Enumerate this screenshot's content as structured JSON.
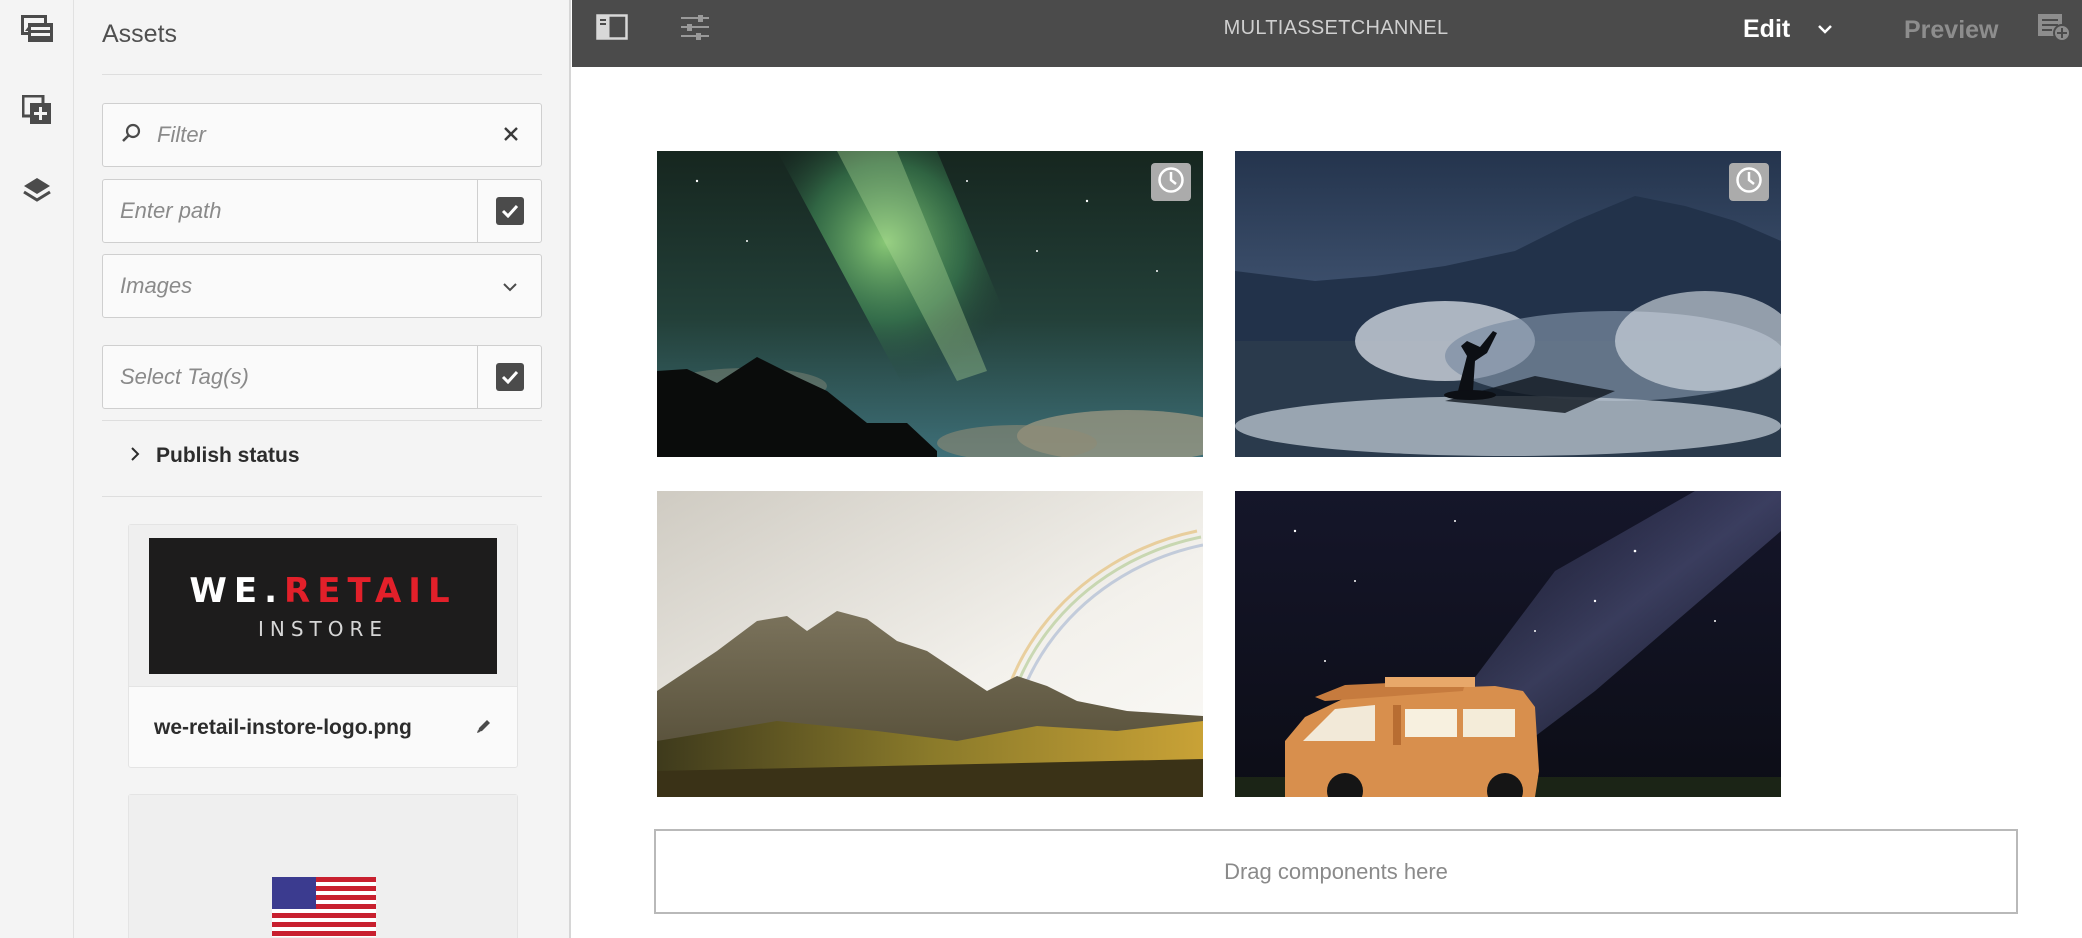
{
  "rail": {
    "items": [
      {
        "icon": "channel-assets-icon"
      },
      {
        "icon": "add-component-icon"
      },
      {
        "icon": "layers-icon"
      }
    ]
  },
  "panel": {
    "title": "Assets",
    "filter": {
      "placeholder": "Filter"
    },
    "path": {
      "placeholder": "Enter path"
    },
    "type_select": {
      "value": "Images"
    },
    "tags": {
      "placeholder": "Select Tag(s)"
    },
    "publish_status": {
      "label": "Publish status"
    },
    "assets": [
      {
        "name": "we-retail-instore-logo.png",
        "logo_line1_a": "WE.",
        "logo_line1_b": "RETAIL",
        "logo_line2": "INSTORE"
      },
      {
        "name": ""
      }
    ]
  },
  "topbar": {
    "title": "MULTIASSETCHANNEL",
    "mode": "Edit",
    "preview": "Preview"
  },
  "canvas": {
    "tiles": [
      {
        "scene": "aurora",
        "scheduled": true
      },
      {
        "scene": "surfer",
        "scheduled": true
      },
      {
        "scene": "rainbow-mountains",
        "scheduled": false
      },
      {
        "scene": "van-at-night",
        "scheduled": false
      }
    ],
    "dropzone_text": "Drag components here"
  },
  "colors": {
    "topbar": "#4b4b4b",
    "panel": "#f4f4f4",
    "brand_red": "#e2202a"
  }
}
